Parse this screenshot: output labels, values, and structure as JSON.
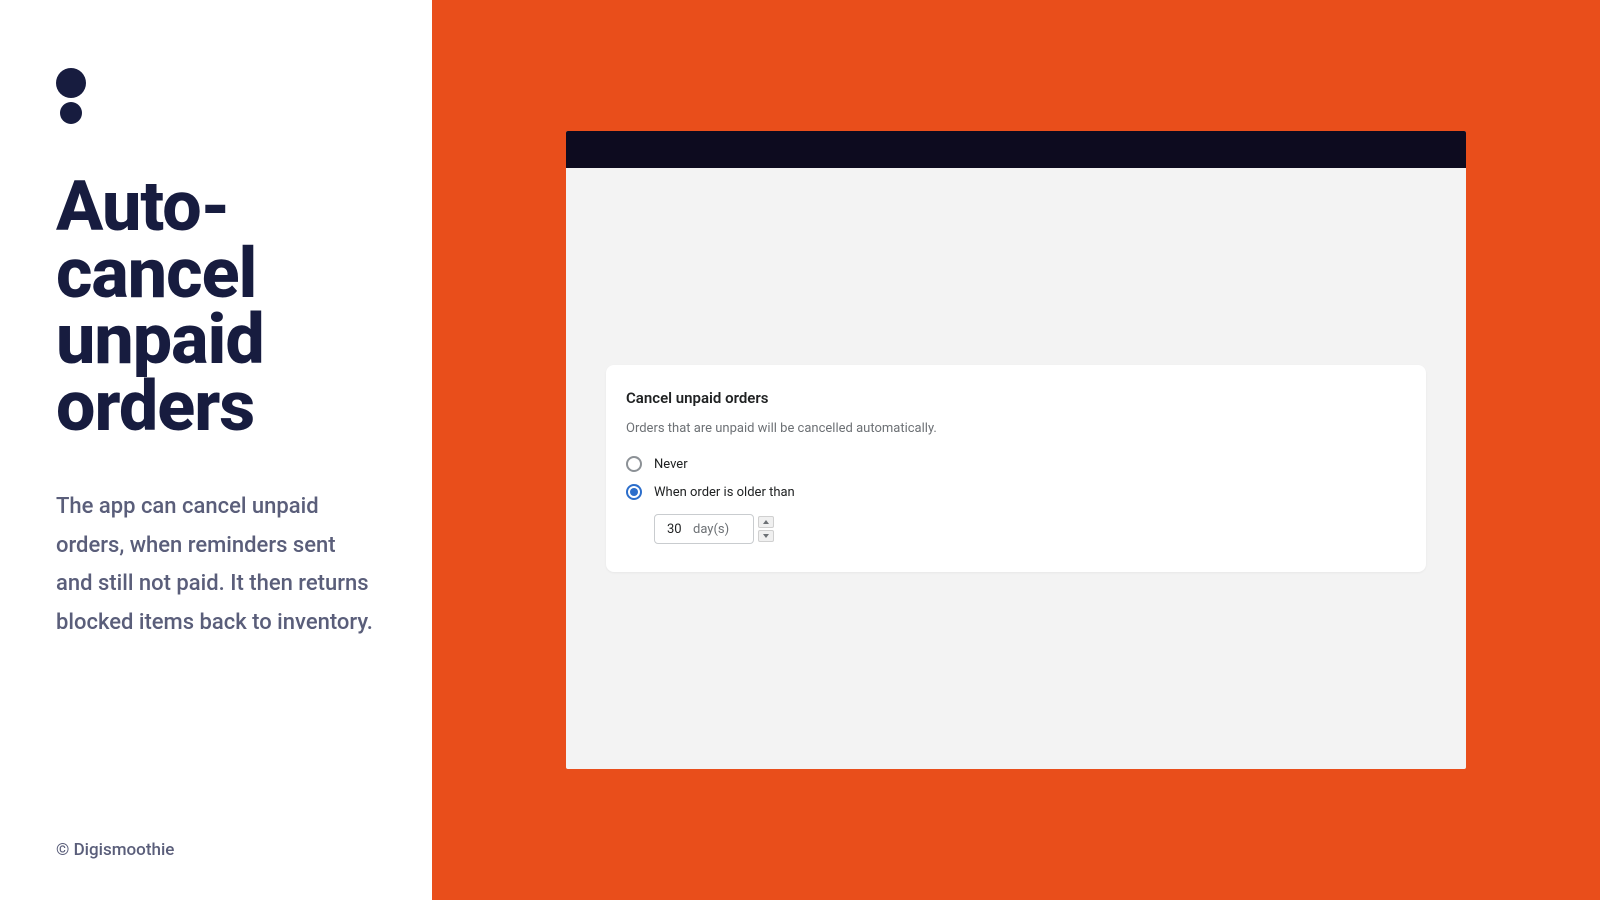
{
  "left": {
    "heading": "Auto-cancel unpaid orders",
    "description": "The app can cancel unpaid orders, when reminders sent and still not paid. It then returns blocked items back to inventory.",
    "copyright": "© Digismoothie"
  },
  "card": {
    "title": "Cancel unpaid orders",
    "subtitle": "Orders that are unpaid will be cancelled automatically.",
    "option_never": "Never",
    "option_older": "When order is older than",
    "days_value": "30",
    "days_unit": "day(s)"
  },
  "colors": {
    "brand_dark": "#171c3f",
    "accent_orange": "#e94e1b",
    "radio_selected": "#2c6ecb"
  }
}
